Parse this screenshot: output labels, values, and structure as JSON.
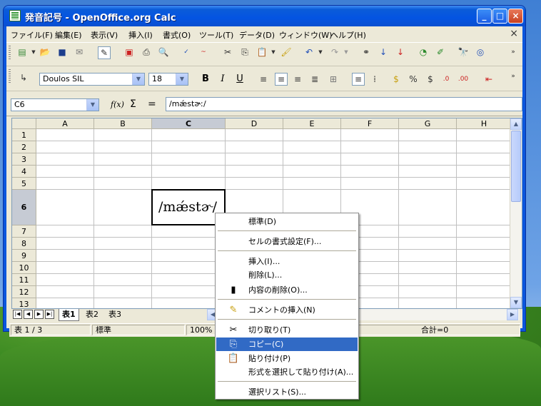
{
  "window": {
    "title": "発音記号 - OpenOffice.org Calc",
    "min_label": "_",
    "max_label": "□",
    "close_label": "×"
  },
  "menubar": {
    "items": [
      "ファイル(F)",
      "編集(E)",
      "表示(V)",
      "挿入(I)",
      "書式(O)",
      "ツール(T)",
      "データ(D)",
      "ウィンドウ(W)",
      "ヘルプ(H)"
    ],
    "doc_close": "×"
  },
  "format_bar": {
    "font_name": "Doulos SIL",
    "font_size": "18",
    "bold": "B",
    "italic": "I",
    "underline": "U"
  },
  "formula_bar": {
    "cell_ref": "C6",
    "fx_label": "f(x)",
    "sum_label": "Σ",
    "eq_label": "=",
    "content": "/mǽstɚː/"
  },
  "sheet": {
    "columns": [
      "A",
      "B",
      "C",
      "D",
      "E",
      "F",
      "G",
      "H"
    ],
    "rows": [
      "1",
      "2",
      "3",
      "4",
      "5",
      "6",
      "7",
      "8",
      "9",
      "10",
      "11",
      "12",
      "13"
    ],
    "selected_col": "C",
    "selected_row": "6",
    "active_cell_value": "/mǽstɚ/"
  },
  "tabs": {
    "names": [
      "表1",
      "表2",
      "表3"
    ],
    "active": "表1"
  },
  "statusbar": {
    "sheet_pos": "表 1 / 3",
    "style": "標準",
    "zoom": "100%",
    "sum": "合計=0"
  },
  "context_menu": {
    "items": [
      {
        "label": "標準(D)",
        "icon": ""
      },
      {
        "label": "セルの書式設定(F)...",
        "icon": ""
      },
      {
        "label": "挿入(I)...",
        "icon": ""
      },
      {
        "label": "削除(L)...",
        "icon": ""
      },
      {
        "label": "内容の削除(O)...",
        "icon": "eraser-icon"
      },
      {
        "label": "コメントの挿入(N)",
        "icon": "comment-icon"
      },
      {
        "label": "切り取り(T)",
        "icon": "scissors-icon"
      },
      {
        "label": "コピー(C)",
        "icon": "copy-icon"
      },
      {
        "label": "貼り付け(P)",
        "icon": "paste-icon"
      },
      {
        "label": "形式を選択して貼り付け(A)...",
        "icon": ""
      },
      {
        "label": "選択リスト(S)...",
        "icon": ""
      }
    ],
    "highlighted": "コピー(C)"
  }
}
